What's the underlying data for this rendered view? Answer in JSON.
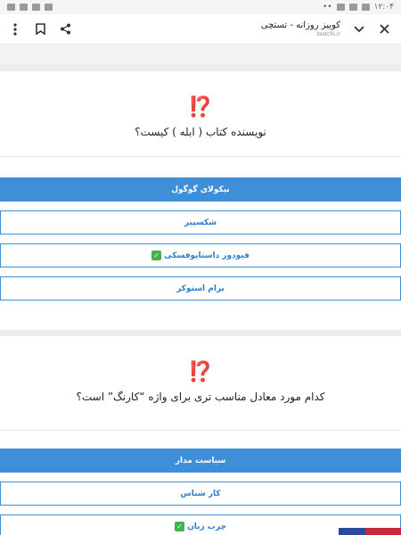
{
  "status_bar": {
    "time": "۱۲:۰۴",
    "more": "••"
  },
  "app_bar": {
    "title": "کوییز روزانه - تستچی",
    "url": "testchi.ir"
  },
  "questions": [
    {
      "mark": "⁉️",
      "text": "نویسنده کتاب ( ابله ) کیست؟",
      "answers": [
        {
          "label": "نیکولای گوگول",
          "selected": true,
          "check": false
        },
        {
          "label": "شکسپیر",
          "selected": false,
          "check": false
        },
        {
          "label": "فیودور داستایوفسکی",
          "selected": false,
          "check": true
        },
        {
          "label": "برام استوکر",
          "selected": false,
          "check": false
        }
      ]
    },
    {
      "mark": "⁉️",
      "text": "کدام مورد معادل مناسب تری برای واژه “کارنگ” است؟",
      "answers": [
        {
          "label": "سیاست مدار",
          "selected": true,
          "check": false
        },
        {
          "label": "کار شناس",
          "selected": false,
          "check": false
        },
        {
          "label": "چرب زبان",
          "selected": false,
          "check": true
        }
      ]
    }
  ],
  "check_glyph": "✓",
  "colors": {
    "accent": "#3e8fd8",
    "red": "#e02020",
    "check": "#3fb34f"
  }
}
